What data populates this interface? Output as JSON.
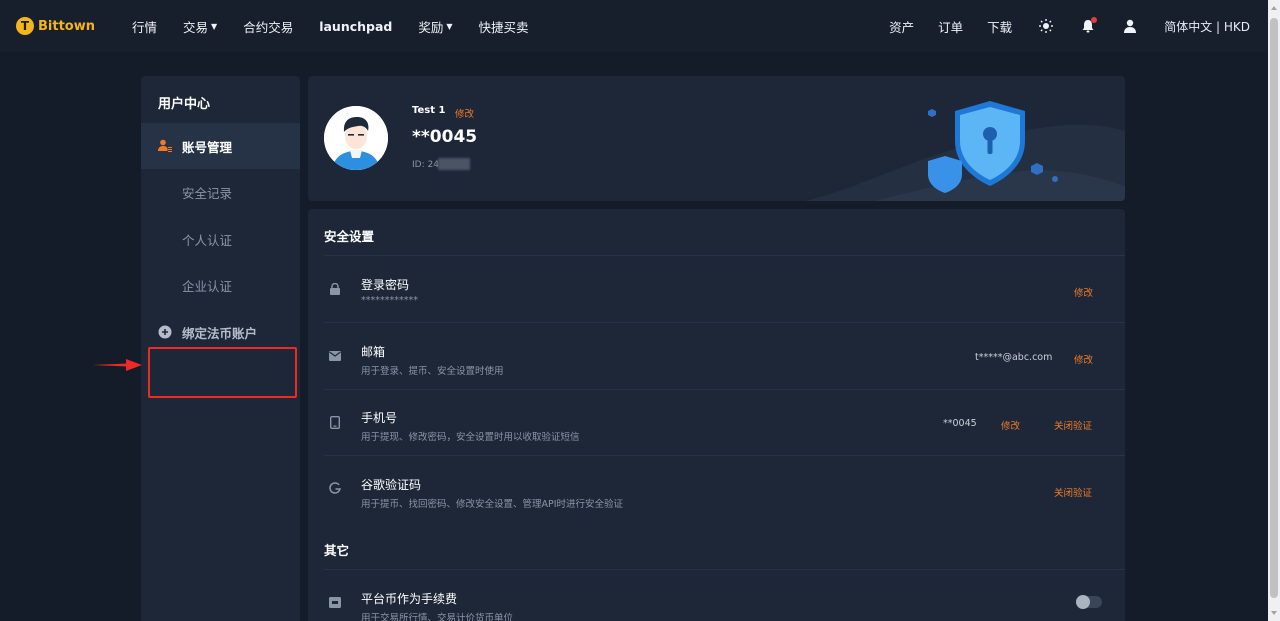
{
  "brand": {
    "logo_letter": "T",
    "name": "Bittown"
  },
  "nav": {
    "left": [
      {
        "label": "行情",
        "caret": false
      },
      {
        "label": "交易",
        "caret": true
      },
      {
        "label": "合约交易",
        "caret": false
      },
      {
        "label": "launchpad",
        "caret": false
      },
      {
        "label": "奖励",
        "caret": true
      },
      {
        "label": "快捷买卖",
        "caret": false
      }
    ],
    "right": [
      "资产",
      "订单",
      "下载"
    ],
    "language": "简体中文 | HKD"
  },
  "sidebar": {
    "title": "用户中心",
    "items": [
      {
        "label": "账号管理",
        "icon": "user-gear-icon"
      },
      {
        "label": "安全记录"
      },
      {
        "label": "个人认证"
      },
      {
        "label": "企业认证"
      },
      {
        "label": "绑定法币账户",
        "icon": "plus-circle-icon"
      }
    ]
  },
  "profile": {
    "name": "Test 1",
    "edit_label": "修改",
    "account": "**0045",
    "id_label": "ID: 24"
  },
  "security": {
    "title": "安全设置",
    "rows": [
      {
        "title": "登录密码",
        "sub": "************",
        "icon": "lock-icon",
        "value": "",
        "links": [
          "修改"
        ]
      },
      {
        "title": "邮箱",
        "sub": "用于登录、提币、安全设置时使用",
        "icon": "mail-icon",
        "value": "t*****@abc.com",
        "links": [
          "修改"
        ]
      },
      {
        "title": "手机号",
        "sub": "用于提现、修改密码，安全设置时用以收取验证短信",
        "icon": "phone-icon",
        "value": "**0045",
        "links": [
          "修改",
          "关闭验证"
        ]
      },
      {
        "title": "谷歌验证码",
        "sub": "用于提币、找回密码、修改安全设置、管理API时进行安全验证",
        "icon": "google-icon",
        "value": "",
        "links": [
          "关闭验证"
        ]
      }
    ],
    "other_title": "其它",
    "other_rows": [
      {
        "title": "平台币作为手续费",
        "sub": "用于交易所行情、交易计价货币单位",
        "icon": "coin-icon",
        "toggle_on": false
      }
    ]
  },
  "colors": {
    "accent": "#f07b27",
    "brand": "#f3b41e",
    "annotation": "#ee2a24"
  }
}
